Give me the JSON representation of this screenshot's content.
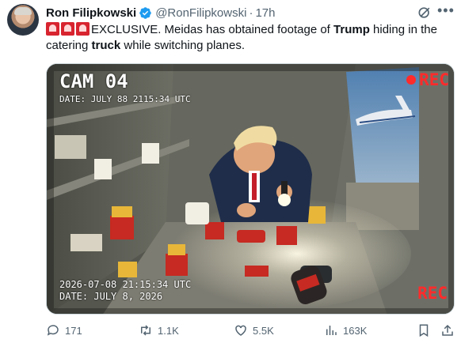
{
  "author": {
    "name": "Ron Filipkowski",
    "handle": "@RonFilipkowski",
    "separator": "·",
    "time": "17h",
    "verified": true
  },
  "tweet": {
    "emoji_icons": [
      "rotating-light-icon",
      "rotating-light-icon",
      "rotating-light-icon"
    ],
    "text_1": "EXCLUSIVE. Meidas has obtained footage of ",
    "bold_1": "Trump",
    "text_2": " hiding in the catering ",
    "bold_2": "truck",
    "text_3": " while switching planes."
  },
  "media": {
    "cam_title": "CAM 04",
    "cam_date": "DATE: JULY 88 2115:34 UTC",
    "rec_top": "REC",
    "stamp_line_1": "2026-07-08 21:15:34 UTC",
    "stamp_line_2": "DATE:  JULY 8, 2026",
    "rec_bottom": "REC",
    "colors": {
      "rec": "#ff2b2b",
      "suit": "#1f2d4a"
    }
  },
  "actions": {
    "replies": "171",
    "reposts": "1.1K",
    "likes": "5.5K",
    "views": "163K"
  },
  "colors": {
    "text": "#0f1419",
    "secondary": "#536471",
    "verified": "#1d9bf0"
  }
}
